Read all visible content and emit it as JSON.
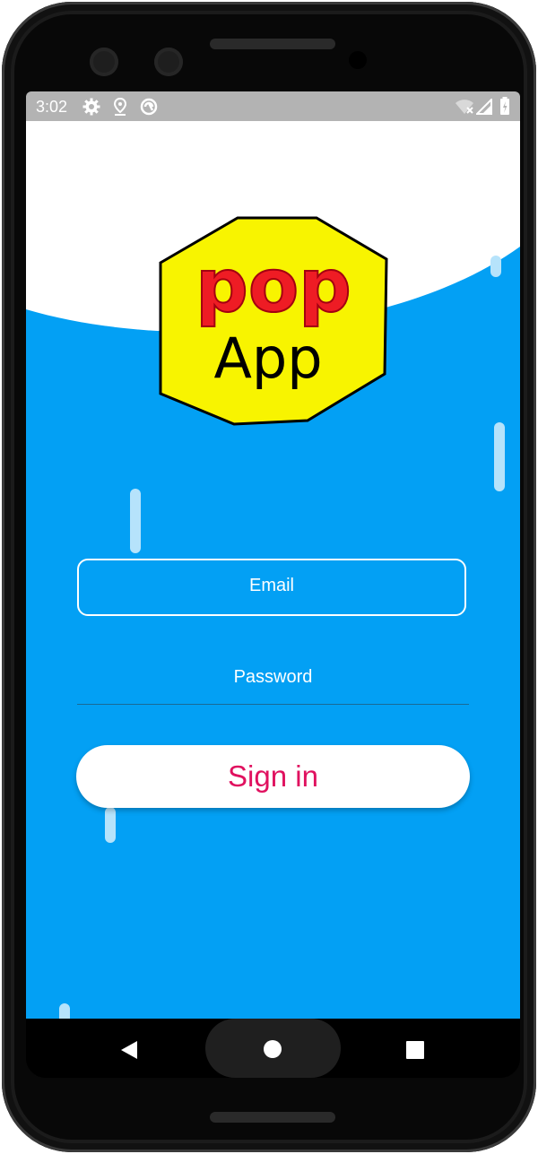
{
  "statusbar": {
    "time": "3:02",
    "left_icons": [
      "gear-icon",
      "location-pin-icon",
      "sync-icon"
    ],
    "right_icons": [
      "wifi-off-icon",
      "signal-icon",
      "battery-charging-icon"
    ]
  },
  "app": {
    "logo": {
      "line1": "pop",
      "line2": "App"
    },
    "email": {
      "placeholder": "Email"
    },
    "password": {
      "placeholder": "Password"
    },
    "signin_label": "Sign in"
  },
  "navbar": {
    "back": "back-icon",
    "home": "home-icon",
    "recents": "recents-icon"
  },
  "colors": {
    "background": "#03a0f4",
    "accent": "#e0115f",
    "logo_yellow": "#f8f400",
    "logo_red": "#ee1c24",
    "statusbar": "#b3b3b3"
  }
}
